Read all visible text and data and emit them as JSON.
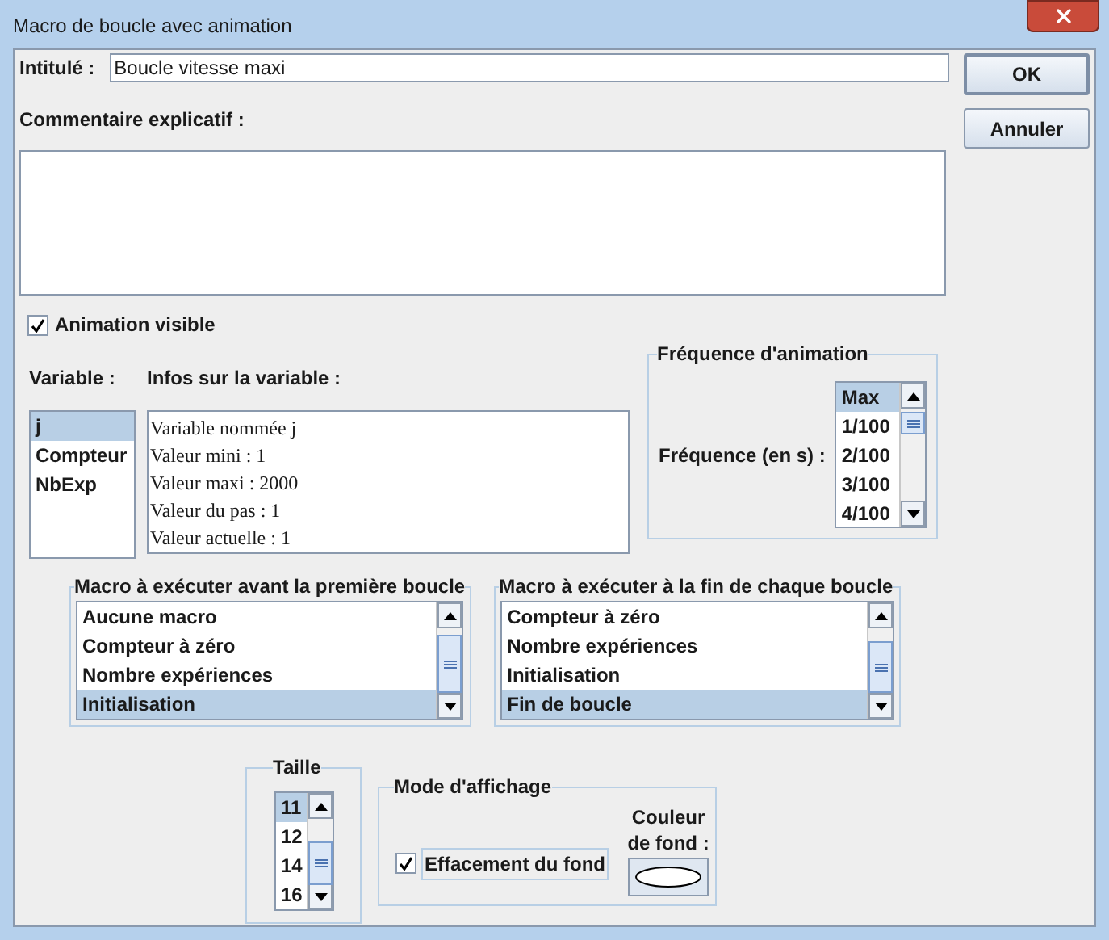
{
  "window": {
    "title": "Macro de boucle avec animation"
  },
  "title_field": {
    "label": "Intitulé :",
    "value": "Boucle vitesse maxi"
  },
  "comment": {
    "label": "Commentaire explicatif :"
  },
  "buttons": [
    {
      "label": "OK",
      "default": true
    },
    {
      "label": "Annuler",
      "default": false
    }
  ],
  "animation_visible": {
    "label": "Animation visible",
    "checked": true
  },
  "variable": {
    "label": "Variable :",
    "items": [
      {
        "text": "j",
        "selected": true
      },
      {
        "text": "Compteur",
        "selected": false
      },
      {
        "text": "NbExp",
        "selected": false
      }
    ]
  },
  "infos": {
    "label": "Infos sur la variable :",
    "lines": [
      "Variable nommée j",
      "Valeur mini : 1",
      "Valeur maxi : 2000",
      "Valeur du pas : 1",
      "Valeur actuelle : 1"
    ]
  },
  "frequency": {
    "title": "Fréquence d'animation",
    "label": "Fréquence (en s) :",
    "items": [
      {
        "text": "Max",
        "selected": true
      },
      {
        "text": "1/100",
        "selected": false
      },
      {
        "text": "2/100",
        "selected": false
      },
      {
        "text": "3/100",
        "selected": false
      },
      {
        "text": "4/100",
        "selected": false
      }
    ]
  },
  "macro_before": {
    "title": "Macro à exécuter avant la première boucle",
    "items": [
      {
        "text": "Aucune macro",
        "selected": false
      },
      {
        "text": "Compteur à zéro",
        "selected": false
      },
      {
        "text": "Nombre expériences",
        "selected": false
      },
      {
        "text": "Initialisation",
        "selected": true
      }
    ]
  },
  "macro_after": {
    "title": "Macro à exécuter à la fin de chaque boucle",
    "items": [
      {
        "text": "Compteur à zéro",
        "selected": false
      },
      {
        "text": "Nombre expériences",
        "selected": false
      },
      {
        "text": "Initialisation",
        "selected": false
      },
      {
        "text": "Fin de boucle",
        "selected": true
      }
    ]
  },
  "size": {
    "title": "Taille",
    "items": [
      {
        "text": "11",
        "selected": true
      },
      {
        "text": "12",
        "selected": false
      },
      {
        "text": "14",
        "selected": false
      },
      {
        "text": "16",
        "selected": false
      }
    ]
  },
  "display_mode": {
    "title": "Mode d'affichage",
    "erase_background": {
      "label": "Effacement du fond",
      "checked": true
    },
    "background_color": {
      "label": "Couleur de fond :"
    }
  }
}
